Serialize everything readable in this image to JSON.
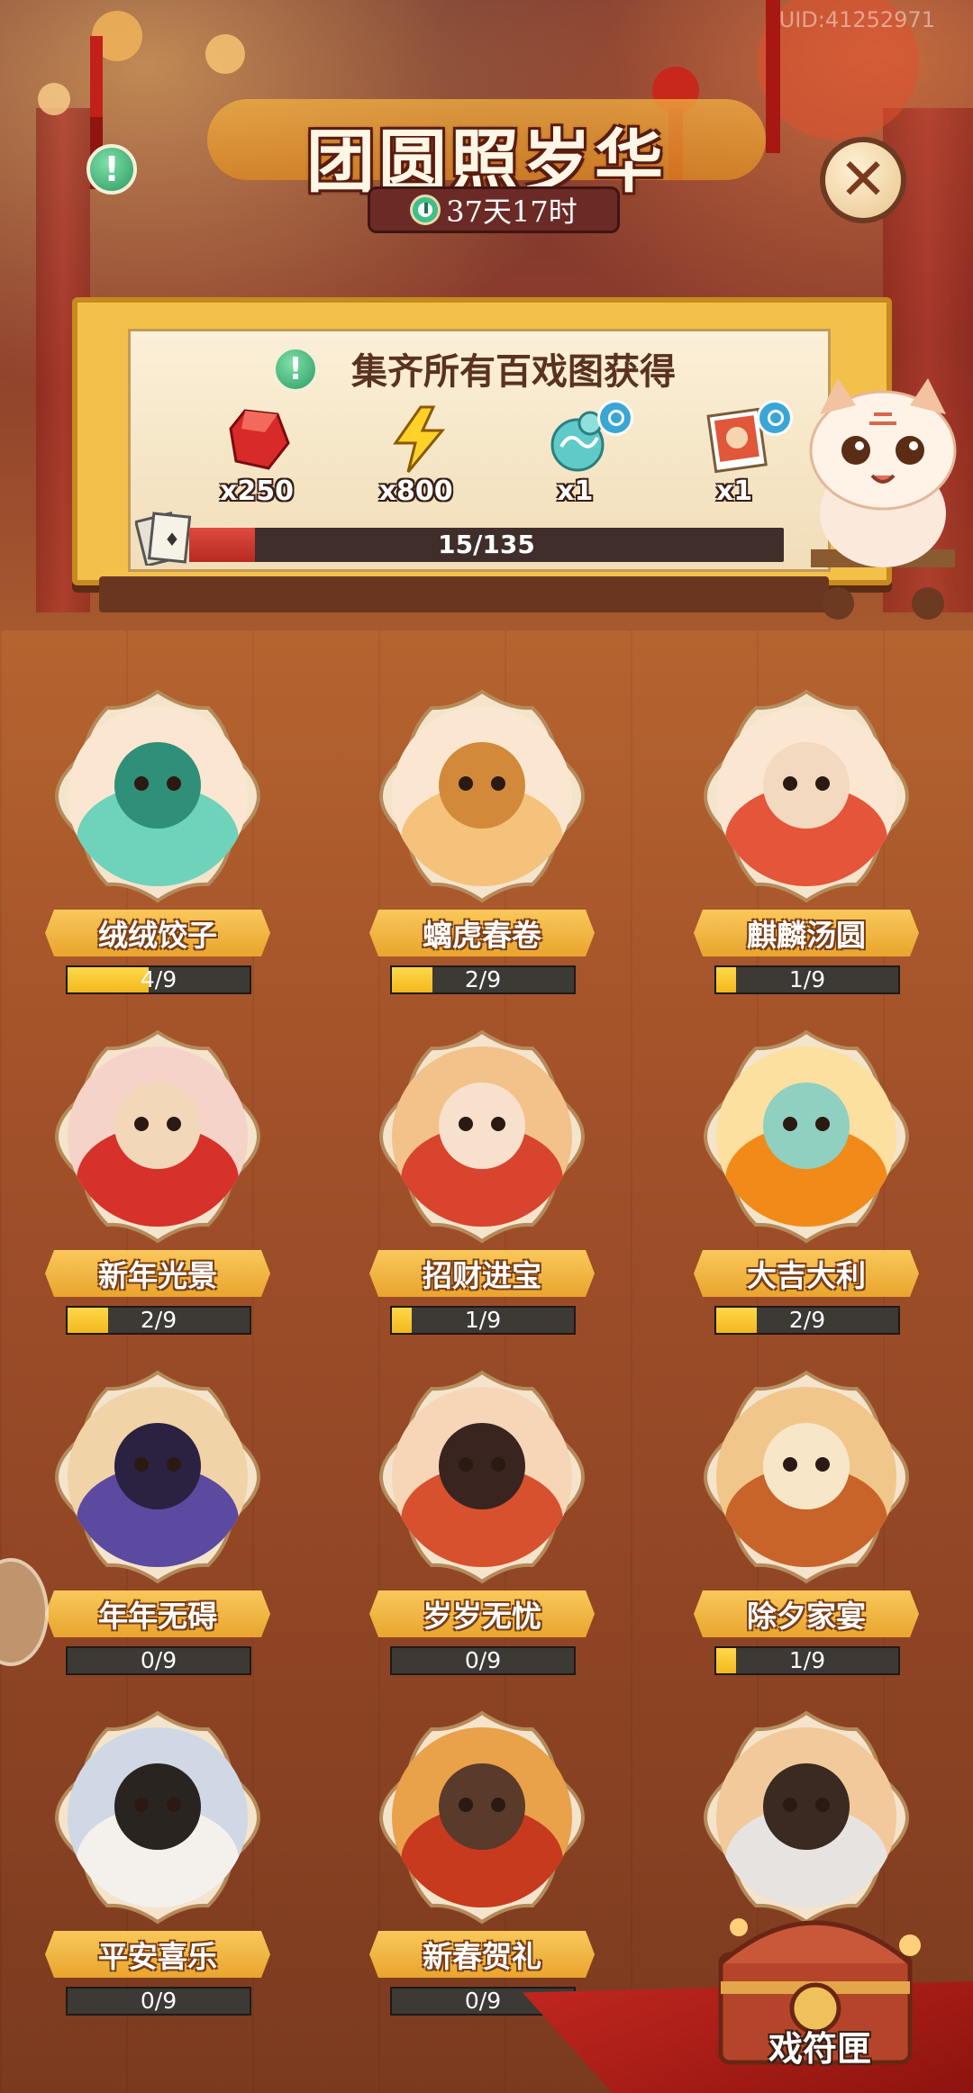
{
  "uid": "UID:41252971",
  "header": {
    "title": "团圆照岁华",
    "timer": "37天17时"
  },
  "reward_panel": {
    "title": "集齐所有百戏图获得",
    "rewards": [
      {
        "icon": "ruby-gem-icon",
        "qty": "x250"
      },
      {
        "icon": "lightning-bolt-icon",
        "qty": "x800"
      },
      {
        "icon": "jade-cloud-item-icon",
        "qty": "x1"
      },
      {
        "icon": "portrait-card-icon",
        "qty": "x1"
      }
    ],
    "progress_text": "15/135",
    "progress_value": 0.111
  },
  "cards": [
    {
      "name": "绒绒饺子",
      "progress": "4/9",
      "fraction": 0.444,
      "art": "dragon-dumpling"
    },
    {
      "name": "螭虎春卷",
      "progress": "2/9",
      "fraction": 0.222,
      "art": "tiger-springroll"
    },
    {
      "name": "麒麟汤圆",
      "progress": "1/9",
      "fraction": 0.111,
      "art": "qilin-tangyuan"
    },
    {
      "name": "新年光景",
      "progress": "2/9",
      "fraction": 0.222,
      "art": "fu-girl"
    },
    {
      "name": "招财进宝",
      "progress": "1/9",
      "fraction": 0.111,
      "art": "fortune-lady"
    },
    {
      "name": "大吉大利",
      "progress": "2/9",
      "fraction": 0.222,
      "art": "lucky-orange"
    },
    {
      "name": "年年无碍",
      "progress": "0/9",
      "fraction": 0,
      "art": "warrior"
    },
    {
      "name": "岁岁无忧",
      "progress": "0/9",
      "fraction": 0,
      "art": "red-robe-girl"
    },
    {
      "name": "除夕家宴",
      "progress": "1/9",
      "fraction": 0.111,
      "art": "feast"
    },
    {
      "name": "平安喜乐",
      "progress": "0/9",
      "fraction": 0,
      "art": "scholar"
    },
    {
      "name": "新春贺礼",
      "progress": "0/9",
      "fraction": 0,
      "art": "golden-dragon"
    },
    {
      "name": "",
      "progress": "",
      "fraction": 0,
      "art": "silver-hair"
    }
  ],
  "chest": {
    "label": "戏符匣"
  },
  "colors": {
    "banner": "#f2b43a",
    "bar_fill": "#f7c628",
    "progress_red": "#d23b30",
    "info_green": "#3aa872"
  }
}
